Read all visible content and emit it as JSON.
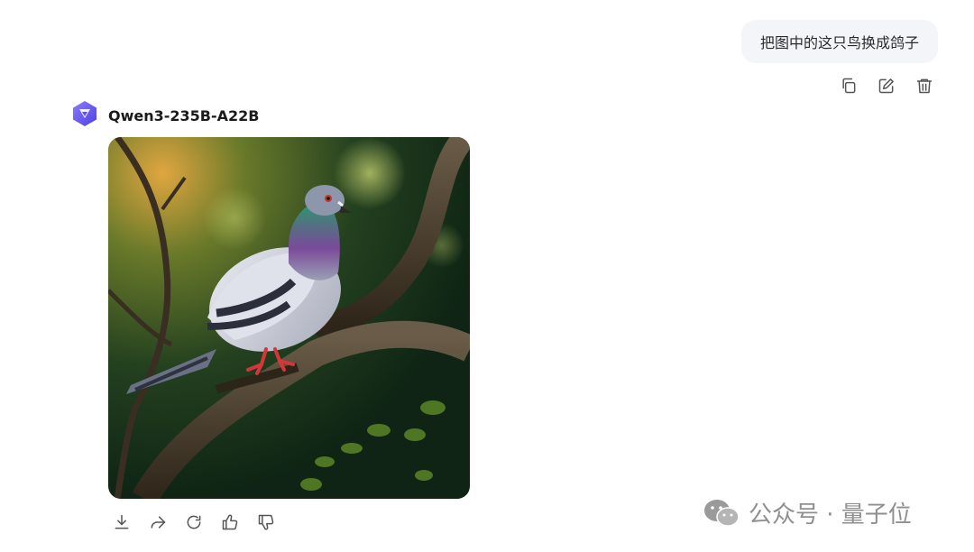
{
  "user_message": {
    "text": "把图中的这只鸟换成鸽子"
  },
  "user_actions": {
    "copy_icon": "copy-icon",
    "edit_icon": "edit-icon",
    "delete_icon": "trash-icon"
  },
  "assistant": {
    "model_name": "Qwen3-235B-A22B",
    "logo_icon": "qwen-logo-icon",
    "logo_color": "#6a5ef6",
    "image_subject": "pigeon-on-branch"
  },
  "reply_actions": {
    "download_icon": "download-icon",
    "share_icon": "share-icon",
    "regenerate_icon": "refresh-icon",
    "like_icon": "thumbs-up-icon",
    "dislike_icon": "thumbs-down-icon"
  },
  "watermark": {
    "text": "公众号 · 量子位",
    "icon": "wechat-icon"
  }
}
